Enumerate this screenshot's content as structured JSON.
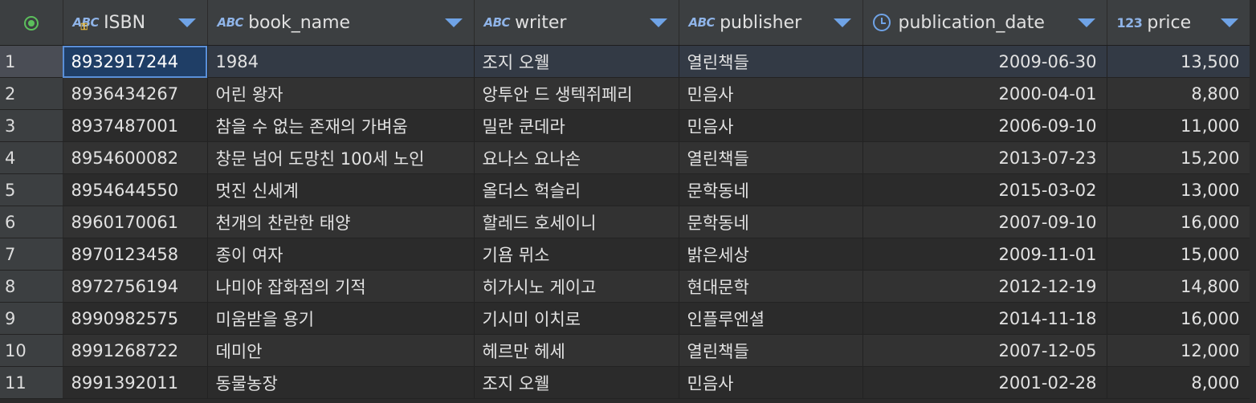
{
  "columns": [
    {
      "name": "ISBN",
      "type_icon": "ABC",
      "type": "text-key"
    },
    {
      "name": "book_name",
      "type_icon": "ABC",
      "type": "text"
    },
    {
      "name": "writer",
      "type_icon": "ABC",
      "type": "text"
    },
    {
      "name": "publisher",
      "type_icon": "ABC",
      "type": "text"
    },
    {
      "name": "publication_date",
      "type_icon": "clock-icon",
      "type": "date"
    },
    {
      "name": "price",
      "type_icon": "123",
      "type": "number"
    }
  ],
  "rows": [
    {
      "num": "1",
      "isbn": "8932917244",
      "book_name": "1984",
      "writer": "조지 오웰",
      "publisher": "열린책들",
      "publication_date": "2009-06-30",
      "price": "13,500"
    },
    {
      "num": "2",
      "isbn": "8936434267",
      "book_name": "어린 왕자",
      "writer": "앙투안 드 생텍쥐페리",
      "publisher": "민음사",
      "publication_date": "2000-04-01",
      "price": "8,800"
    },
    {
      "num": "3",
      "isbn": "8937487001",
      "book_name": "참을 수 없는 존재의 가벼움",
      "writer": "밀란 쿤데라",
      "publisher": "민음사",
      "publication_date": "2006-09-10",
      "price": "11,000"
    },
    {
      "num": "4",
      "isbn": "8954600082",
      "book_name": "창문 넘어 도망친 100세 노인",
      "writer": "요나스 요나손",
      "publisher": "열린책들",
      "publication_date": "2013-07-23",
      "price": "15,200"
    },
    {
      "num": "5",
      "isbn": "8954644550",
      "book_name": "멋진 신세계",
      "writer": "올더스 헉슬리",
      "publisher": "문학동네",
      "publication_date": "2015-03-02",
      "price": "13,000"
    },
    {
      "num": "6",
      "isbn": "8960170061",
      "book_name": "천개의 찬란한 태양",
      "writer": "할레드 호세이니",
      "publisher": "문학동네",
      "publication_date": "2007-09-10",
      "price": "16,000"
    },
    {
      "num": "7",
      "isbn": "8970123458",
      "book_name": "종이 여자",
      "writer": "기욤 뮈소",
      "publisher": "밝은세상",
      "publication_date": "2009-11-01",
      "price": "15,000"
    },
    {
      "num": "8",
      "isbn": "8972756194",
      "book_name": "나미야 잡화점의 기적",
      "writer": "히가시노 게이고",
      "publisher": "현대문학",
      "publication_date": "2012-12-19",
      "price": "14,800"
    },
    {
      "num": "9",
      "isbn": "8990982575",
      "book_name": "미움받을 용기",
      "writer": "기시미 이치로",
      "publisher": "인플루엔셜",
      "publication_date": "2014-11-18",
      "price": "16,000"
    },
    {
      "num": "10",
      "isbn": "8991268722",
      "book_name": "데미안",
      "writer": "헤르만 헤세",
      "publisher": "열린책들",
      "publication_date": "2007-12-05",
      "price": "12,000"
    },
    {
      "num": "11",
      "isbn": "8991392011",
      "book_name": "동물농장",
      "writer": "조지 오웰",
      "publisher": "민음사",
      "publication_date": "2001-02-28",
      "price": "8,000"
    }
  ],
  "colors": {
    "header_bg": "#3c3f41",
    "row_bg": "#2b2b2b",
    "row_alt_bg": "#323232",
    "accent": "#6fa3e6",
    "selection": "#1f3e66"
  }
}
